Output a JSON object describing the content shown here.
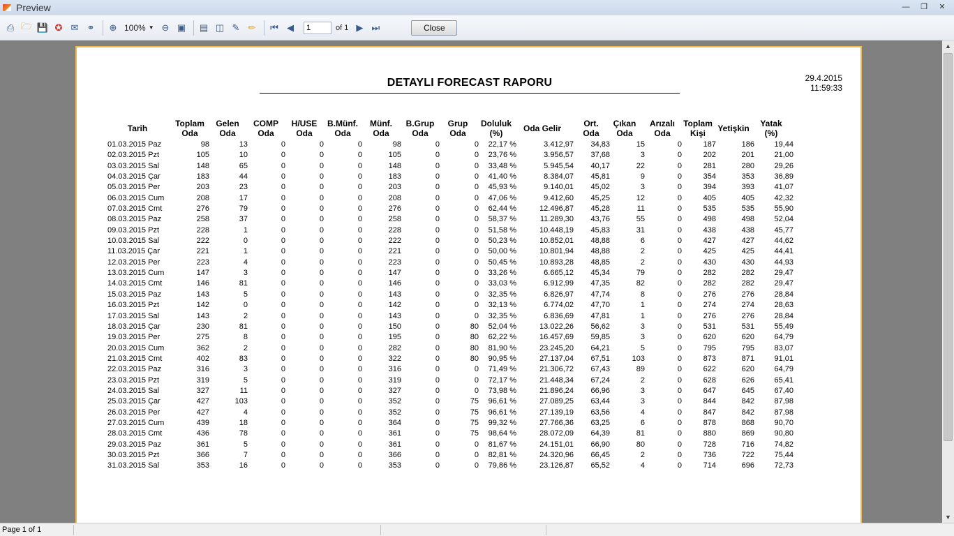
{
  "window": {
    "title": "Preview"
  },
  "toolbar": {
    "zoom": "100%",
    "page_input": "1",
    "page_of": "of 1",
    "close_label": "Close",
    "icons": [
      "print-icon",
      "open-icon",
      "save-icon",
      "pdf-icon",
      "email-icon",
      "find-icon",
      "zoom-in-icon",
      "zoom-out-icon",
      "fit-page-icon",
      "single-page-icon",
      "multi-page-icon",
      "background-icon",
      "watermark-icon",
      "first-page-icon",
      "prev-page-icon",
      "next-page-icon",
      "last-page-icon"
    ]
  },
  "report": {
    "title": "DETAYLI FORECAST RAPORU",
    "date": "29.4.2015",
    "time": "11:59:33",
    "columns": [
      {
        "l1": "Tarih",
        "l2": ""
      },
      {
        "l1": "Toplam",
        "l2": "Oda"
      },
      {
        "l1": "Gelen",
        "l2": "Oda"
      },
      {
        "l1": "COMP",
        "l2": "Oda"
      },
      {
        "l1": "H/USE",
        "l2": "Oda"
      },
      {
        "l1": "B.Münf.",
        "l2": "Oda"
      },
      {
        "l1": "Münf.",
        "l2": "Oda"
      },
      {
        "l1": "B.Grup",
        "l2": "Oda"
      },
      {
        "l1": "Grup",
        "l2": "Oda"
      },
      {
        "l1": "Doluluk",
        "l2": "(%)"
      },
      {
        "l1": "Oda Gelir",
        "l2": ""
      },
      {
        "l1": "Ort.",
        "l2": "Oda"
      },
      {
        "l1": "Çıkan",
        "l2": "Oda"
      },
      {
        "l1": "Arızalı",
        "l2": "Oda"
      },
      {
        "l1": "Toplam",
        "l2": "Kişi"
      },
      {
        "l1": "Yetişkin",
        "l2": ""
      },
      {
        "l1": "Yatak",
        "l2": "(%)"
      }
    ],
    "rows": [
      [
        "01.03.2015 Paz",
        "98",
        "13",
        "0",
        "0",
        "0",
        "98",
        "0",
        "0",
        "22,17 %",
        "3.412,97",
        "34,83",
        "15",
        "0",
        "187",
        "186",
        "19,44"
      ],
      [
        "02.03.2015 Pzt",
        "105",
        "10",
        "0",
        "0",
        "0",
        "105",
        "0",
        "0",
        "23,76 %",
        "3.956,57",
        "37,68",
        "3",
        "0",
        "202",
        "201",
        "21,00"
      ],
      [
        "03.03.2015 Sal",
        "148",
        "65",
        "0",
        "0",
        "0",
        "148",
        "0",
        "0",
        "33,48 %",
        "5.945,54",
        "40,17",
        "22",
        "0",
        "281",
        "280",
        "29,26"
      ],
      [
        "04.03.2015 Çar",
        "183",
        "44",
        "0",
        "0",
        "0",
        "183",
        "0",
        "0",
        "41,40 %",
        "8.384,07",
        "45,81",
        "9",
        "0",
        "354",
        "353",
        "36,89"
      ],
      [
        "05.03.2015 Per",
        "203",
        "23",
        "0",
        "0",
        "0",
        "203",
        "0",
        "0",
        "45,93 %",
        "9.140,01",
        "45,02",
        "3",
        "0",
        "394",
        "393",
        "41,07"
      ],
      [
        "06.03.2015 Cum",
        "208",
        "17",
        "0",
        "0",
        "0",
        "208",
        "0",
        "0",
        "47,06 %",
        "9.412,60",
        "45,25",
        "12",
        "0",
        "405",
        "405",
        "42,32"
      ],
      [
        "07.03.2015 Cmt",
        "276",
        "79",
        "0",
        "0",
        "0",
        "276",
        "0",
        "0",
        "62,44 %",
        "12.496,87",
        "45,28",
        "11",
        "0",
        "535",
        "535",
        "55,90"
      ],
      [
        "08.03.2015 Paz",
        "258",
        "37",
        "0",
        "0",
        "0",
        "258",
        "0",
        "0",
        "58,37 %",
        "11.289,30",
        "43,76",
        "55",
        "0",
        "498",
        "498",
        "52,04"
      ],
      [
        "09.03.2015 Pzt",
        "228",
        "1",
        "0",
        "0",
        "0",
        "228",
        "0",
        "0",
        "51,58 %",
        "10.448,19",
        "45,83",
        "31",
        "0",
        "438",
        "438",
        "45,77"
      ],
      [
        "10.03.2015 Sal",
        "222",
        "0",
        "0",
        "0",
        "0",
        "222",
        "0",
        "0",
        "50,23 %",
        "10.852,01",
        "48,88",
        "6",
        "0",
        "427",
        "427",
        "44,62"
      ],
      [
        "11.03.2015 Çar",
        "221",
        "1",
        "0",
        "0",
        "0",
        "221",
        "0",
        "0",
        "50,00 %",
        "10.801,94",
        "48,88",
        "2",
        "0",
        "425",
        "425",
        "44,41"
      ],
      [
        "12.03.2015 Per",
        "223",
        "4",
        "0",
        "0",
        "0",
        "223",
        "0",
        "0",
        "50,45 %",
        "10.893,28",
        "48,85",
        "2",
        "0",
        "430",
        "430",
        "44,93"
      ],
      [
        "13.03.2015 Cum",
        "147",
        "3",
        "0",
        "0",
        "0",
        "147",
        "0",
        "0",
        "33,26 %",
        "6.665,12",
        "45,34",
        "79",
        "0",
        "282",
        "282",
        "29,47"
      ],
      [
        "14.03.2015 Cmt",
        "146",
        "81",
        "0",
        "0",
        "0",
        "146",
        "0",
        "0",
        "33,03 %",
        "6.912,99",
        "47,35",
        "82",
        "0",
        "282",
        "282",
        "29,47"
      ],
      [
        "15.03.2015 Paz",
        "143",
        "5",
        "0",
        "0",
        "0",
        "143",
        "0",
        "0",
        "32,35 %",
        "6.826,97",
        "47,74",
        "8",
        "0",
        "276",
        "276",
        "28,84"
      ],
      [
        "16.03.2015 Pzt",
        "142",
        "0",
        "0",
        "0",
        "0",
        "142",
        "0",
        "0",
        "32,13 %",
        "6.774,02",
        "47,70",
        "1",
        "0",
        "274",
        "274",
        "28,63"
      ],
      [
        "17.03.2015 Sal",
        "143",
        "2",
        "0",
        "0",
        "0",
        "143",
        "0",
        "0",
        "32,35 %",
        "6.836,69",
        "47,81",
        "1",
        "0",
        "276",
        "276",
        "28,84"
      ],
      [
        "18.03.2015 Çar",
        "230",
        "81",
        "0",
        "0",
        "0",
        "150",
        "0",
        "80",
        "52,04 %",
        "13.022,26",
        "56,62",
        "3",
        "0",
        "531",
        "531",
        "55,49"
      ],
      [
        "19.03.2015 Per",
        "275",
        "8",
        "0",
        "0",
        "0",
        "195",
        "0",
        "80",
        "62,22 %",
        "16.457,69",
        "59,85",
        "3",
        "0",
        "620",
        "620",
        "64,79"
      ],
      [
        "20.03.2015 Cum",
        "362",
        "2",
        "0",
        "0",
        "0",
        "282",
        "0",
        "80",
        "81,90 %",
        "23.245,20",
        "64,21",
        "5",
        "0",
        "795",
        "795",
        "83,07"
      ],
      [
        "21.03.2015 Cmt",
        "402",
        "83",
        "0",
        "0",
        "0",
        "322",
        "0",
        "80",
        "90,95 %",
        "27.137,04",
        "67,51",
        "103",
        "0",
        "873",
        "871",
        "91,01"
      ],
      [
        "22.03.2015 Paz",
        "316",
        "3",
        "0",
        "0",
        "0",
        "316",
        "0",
        "0",
        "71,49 %",
        "21.306,72",
        "67,43",
        "89",
        "0",
        "622",
        "620",
        "64,79"
      ],
      [
        "23.03.2015 Pzt",
        "319",
        "5",
        "0",
        "0",
        "0",
        "319",
        "0",
        "0",
        "72,17 %",
        "21.448,34",
        "67,24",
        "2",
        "0",
        "628",
        "626",
        "65,41"
      ],
      [
        "24.03.2015 Sal",
        "327",
        "11",
        "0",
        "0",
        "0",
        "327",
        "0",
        "0",
        "73,98 %",
        "21.896,24",
        "66,96",
        "3",
        "0",
        "647",
        "645",
        "67,40"
      ],
      [
        "25.03.2015 Çar",
        "427",
        "103",
        "0",
        "0",
        "0",
        "352",
        "0",
        "75",
        "96,61 %",
        "27.089,25",
        "63,44",
        "3",
        "0",
        "844",
        "842",
        "87,98"
      ],
      [
        "26.03.2015 Per",
        "427",
        "4",
        "0",
        "0",
        "0",
        "352",
        "0",
        "75",
        "96,61 %",
        "27.139,19",
        "63,56",
        "4",
        "0",
        "847",
        "842",
        "87,98"
      ],
      [
        "27.03.2015 Cum",
        "439",
        "18",
        "0",
        "0",
        "0",
        "364",
        "0",
        "75",
        "99,32 %",
        "27.766,36",
        "63,25",
        "6",
        "0",
        "878",
        "868",
        "90,70"
      ],
      [
        "28.03.2015 Cmt",
        "436",
        "78",
        "0",
        "0",
        "0",
        "361",
        "0",
        "75",
        "98,64 %",
        "28.072,09",
        "64,39",
        "81",
        "0",
        "880",
        "869",
        "90,80"
      ],
      [
        "29.03.2015 Paz",
        "361",
        "5",
        "0",
        "0",
        "0",
        "361",
        "0",
        "0",
        "81,67 %",
        "24.151,01",
        "66,90",
        "80",
        "0",
        "728",
        "716",
        "74,82"
      ],
      [
        "30.03.2015 Pzt",
        "366",
        "7",
        "0",
        "0",
        "0",
        "366",
        "0",
        "0",
        "82,81 %",
        "24.320,96",
        "66,45",
        "2",
        "0",
        "736",
        "722",
        "75,44"
      ],
      [
        "31.03.2015 Sal",
        "353",
        "16",
        "0",
        "0",
        "0",
        "353",
        "0",
        "0",
        "79,86 %",
        "23.126,87",
        "65,52",
        "4",
        "0",
        "714",
        "696",
        "72,73"
      ]
    ]
  },
  "status": {
    "page": "Page 1 of 1"
  }
}
